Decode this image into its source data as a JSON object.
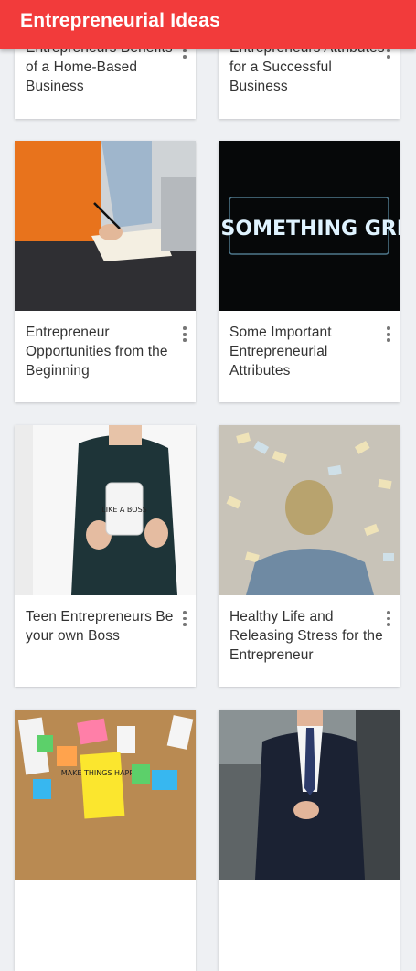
{
  "app": {
    "title": "Entrepreneurial Ideas"
  },
  "cards": [
    {
      "title": "Entrepreneurs Benefits of a Home-Based Business",
      "image": "partially-scrolled"
    },
    {
      "title": "Entrepreneurs Attributes for a Successful Business",
      "image": "partially-scrolled"
    },
    {
      "title": "Entrepreneur Opportunities from the Beginning",
      "image": "person-writing-at-desk"
    },
    {
      "title": "Some Important Entrepreneurial Attributes",
      "image": "neon-sign",
      "image_text": "DO SOMETHING GREAT"
    },
    {
      "title": "Teen Entrepreneurs Be your own Boss",
      "image": "woman-holding-mug",
      "image_text": "LIKE A BOSS"
    },
    {
      "title": "Healthy Life and Releasing Stress for the Entrepreneur",
      "image": "man-covered-in-sticky-notes"
    },
    {
      "title": "",
      "image": "corkboard-notes",
      "image_text": "MAKE THINGS HAPPEN"
    },
    {
      "title": "",
      "image": "businessman-in-suit"
    }
  ],
  "icons": {
    "more": "more-vert-icon"
  },
  "colors": {
    "appbar": "#f23b3b",
    "background": "#eef0f3",
    "card": "#ffffff",
    "text": "#333333"
  }
}
